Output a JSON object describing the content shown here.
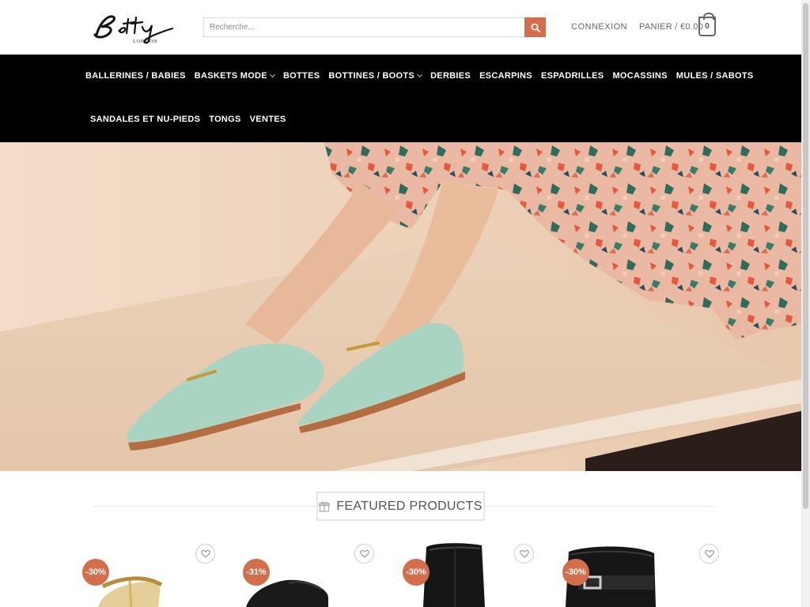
{
  "brand": {
    "name": "Betty",
    "sub": "LONDON"
  },
  "search": {
    "placeholder": "Recherche..."
  },
  "header": {
    "login_label": "CONNEXION",
    "cart_label": "PANIER / €0.00",
    "cart_count": "0"
  },
  "nav": {
    "row1": [
      {
        "label": "BALLERINES / BABIES",
        "dropdown": false
      },
      {
        "label": "BASKETS MODE",
        "dropdown": true
      },
      {
        "label": "BOTTES",
        "dropdown": false
      },
      {
        "label": "BOTTINES / BOOTS",
        "dropdown": true
      },
      {
        "label": "DERBIES",
        "dropdown": false
      },
      {
        "label": "ESCARPINS",
        "dropdown": false
      },
      {
        "label": "ESPADRILLES",
        "dropdown": false
      },
      {
        "label": "MOCASSINS",
        "dropdown": false
      },
      {
        "label": "MULES / SABOTS",
        "dropdown": false
      }
    ],
    "row2": [
      {
        "label": "SANDALES ET NU-PIEDS",
        "dropdown": false
      },
      {
        "label": "TONGS",
        "dropdown": false
      },
      {
        "label": "VENTES",
        "dropdown": false
      }
    ]
  },
  "featured": {
    "title": "FEATURED PRODUCTS"
  },
  "products": [
    {
      "badge": "-30%",
      "image": "gold-sandal"
    },
    {
      "badge": "-31%",
      "image": "black-loafer"
    },
    {
      "badge": "-30%",
      "image": "black-boot"
    },
    {
      "badge": "-30%",
      "image": "black-buckle-boot"
    }
  ],
  "colors": {
    "accent": "#d26e4b",
    "nav_bg": "#000000",
    "mint_shoe": "#a9d4c1"
  }
}
